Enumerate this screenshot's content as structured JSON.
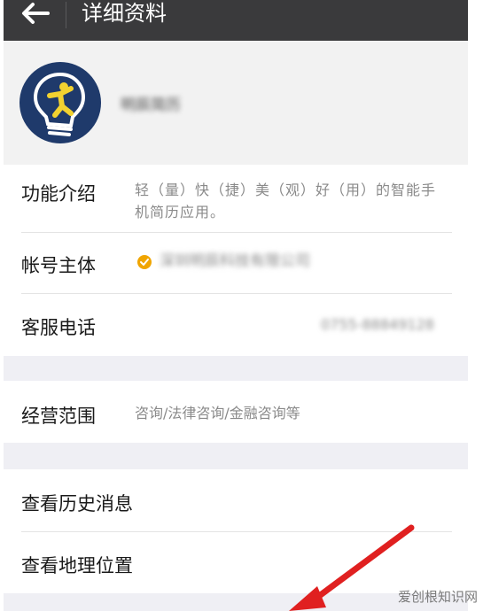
{
  "titlebar": {
    "title": "详细资料",
    "back_icon": "back-arrow-icon"
  },
  "profile": {
    "name": "明辰简历",
    "avatar_icon": "lightbulb-person-logo"
  },
  "info": {
    "intro_label": "功能介绍",
    "intro_value": "轻（量）快（捷）美（观）好（用）的智能手机简历应用。",
    "account_label": "帐号主体",
    "account_value": "深圳明辰科技有限公司",
    "verified_icon": "verified-check-icon",
    "phone_label": "客服电话",
    "phone_value": "0755-88849128"
  },
  "business": {
    "label": "经营范围",
    "value": "咨询/法律咨询/金融咨询等"
  },
  "actions": {
    "history": "查看历史消息",
    "location": "查看地理位置"
  },
  "watermark": "爱创根知识网",
  "colors": {
    "titlebar": "#3a3a3c",
    "arrow": "#e02020",
    "verified": "#f0a500",
    "avatar_bg": "#1f3a6b"
  }
}
